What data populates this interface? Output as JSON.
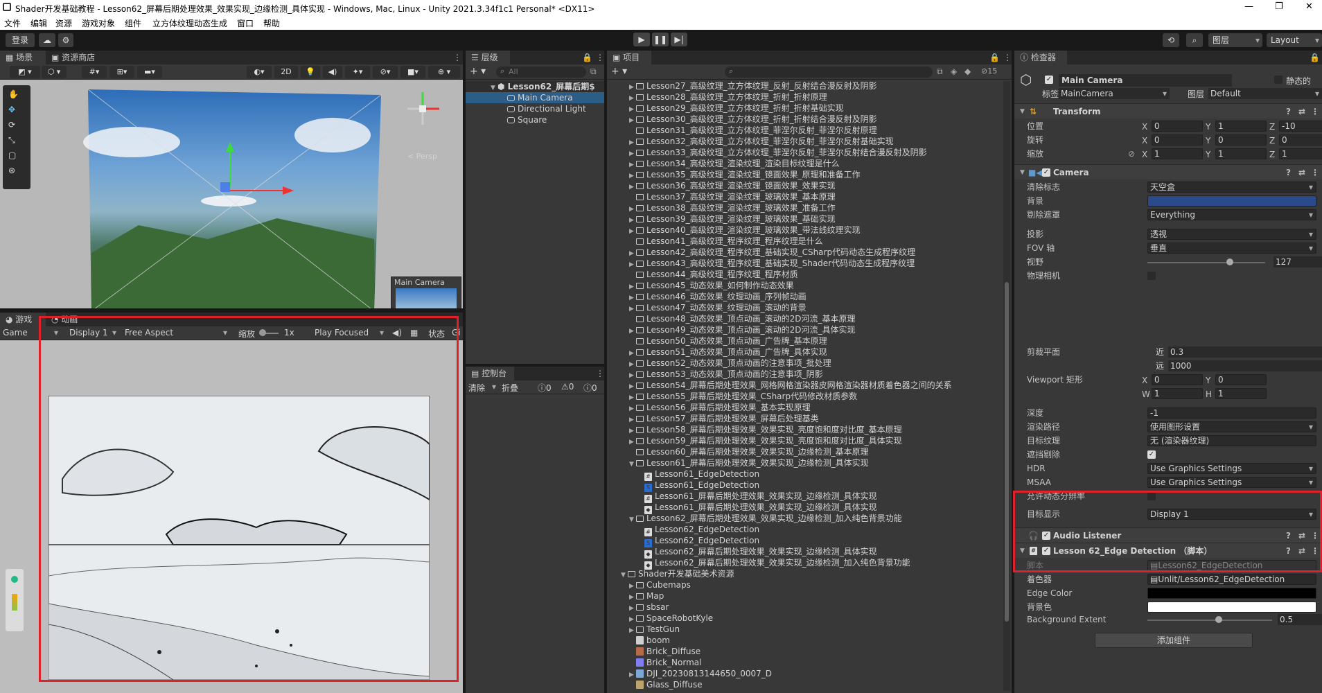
{
  "window": {
    "title": "Shader开发基础教程 - Lesson62_屏幕后期处理效果_效果实现_边缘检测_具体实现 - Windows, Mac, Linux - Unity 2021.3.34f1c1 Personal* <DX11>"
  },
  "menu": [
    "文件",
    "编辑",
    "资源",
    "游戏对象",
    "组件",
    "立方体纹理动态生成",
    "窗口",
    "帮助"
  ],
  "toolbar": {
    "login": "登录",
    "layers": "图层",
    "layout": "Layout"
  },
  "scene": {
    "tab": "场景",
    "store_tab": "资源商店",
    "mode_2d": "2D",
    "persp": "< Persp",
    "cam_preview": "Main Camera"
  },
  "game": {
    "tab": "游戏",
    "anim_tab": "动画",
    "view": "Game",
    "display": "Display 1",
    "aspect": "Free Aspect",
    "scale_label": "缩放",
    "scale_value": "1x",
    "play_mode": "Play Focused",
    "stats": "状态",
    "gizmos": "Gi"
  },
  "hierarchy": {
    "tab": "层级",
    "search": "All",
    "scene": "Lesson62_屏幕后期$",
    "items": [
      "Main Camera",
      "Directional Light",
      "Square"
    ]
  },
  "console": {
    "tab": "控制台",
    "clear": "清除",
    "collapse": "折叠",
    "errors": "0",
    "warnings": "0",
    "logs": "0"
  },
  "project": {
    "tab": "项目",
    "count": "15",
    "rows": [
      {
        "d": 1,
        "f": 1,
        "o": 0,
        "t": "Lesson27_高级纹理_立方体纹理_反射_反射结合漫反射及阴影"
      },
      {
        "d": 1,
        "f": 1,
        "o": 0,
        "t": "Lesson28_高级纹理_立方体纹理_折射_折射原理"
      },
      {
        "d": 1,
        "f": 1,
        "o": 0,
        "t": "Lesson29_高级纹理_立方体纹理_折射_折射基础实现"
      },
      {
        "d": 1,
        "f": 1,
        "o": 0,
        "t": "Lesson30_高级纹理_立方体纹理_折射_折射结合漫反射及阴影"
      },
      {
        "d": 1,
        "f": 0,
        "o": 0,
        "t": "Lesson31_高级纹理_立方体纹理_菲涅尔反射_菲涅尔反射原理"
      },
      {
        "d": 1,
        "f": 1,
        "o": 0,
        "t": "Lesson32_高级纹理_立方体纹理_菲涅尔反射_菲涅尔反射基础实现"
      },
      {
        "d": 1,
        "f": 1,
        "o": 0,
        "t": "Lesson33_高级纹理_立方体纹理_菲涅尔反射_菲涅尔反射结合漫反射及阴影"
      },
      {
        "d": 1,
        "f": 1,
        "o": 0,
        "t": "Lesson34_高级纹理_渲染纹理_渲染目标纹理是什么"
      },
      {
        "d": 1,
        "f": 1,
        "o": 0,
        "t": "Lesson35_高级纹理_渲染纹理_镜面效果_原理和准备工作"
      },
      {
        "d": 1,
        "f": 1,
        "o": 0,
        "t": "Lesson36_高级纹理_渲染纹理_镜面效果_效果实现"
      },
      {
        "d": 1,
        "f": 0,
        "o": 0,
        "t": "Lesson37_高级纹理_渲染纹理_玻璃效果_基本原理"
      },
      {
        "d": 1,
        "f": 1,
        "o": 0,
        "t": "Lesson38_高级纹理_渲染纹理_玻璃效果_准备工作"
      },
      {
        "d": 1,
        "f": 1,
        "o": 0,
        "t": "Lesson39_高级纹理_渲染纹理_玻璃效果_基础实现"
      },
      {
        "d": 1,
        "f": 1,
        "o": 0,
        "t": "Lesson40_高级纹理_渲染纹理_玻璃效果_带法线纹理实现"
      },
      {
        "d": 1,
        "f": 0,
        "o": 0,
        "t": "Lesson41_高级纹理_程序纹理_程序纹理是什么"
      },
      {
        "d": 1,
        "f": 1,
        "o": 0,
        "t": "Lesson42_高级纹理_程序纹理_基础实现_CSharp代码动态生成程序纹理"
      },
      {
        "d": 1,
        "f": 1,
        "o": 0,
        "t": "Lesson43_高级纹理_程序纹理_基础实现_Shader代码动态生成程序纹理"
      },
      {
        "d": 1,
        "f": 0,
        "o": 0,
        "t": "Lesson44_高级纹理_程序纹理_程序材质"
      },
      {
        "d": 1,
        "f": 1,
        "o": 0,
        "t": "Lesson45_动态效果_如何制作动态效果"
      },
      {
        "d": 1,
        "f": 1,
        "o": 0,
        "t": "Lesson46_动态效果_纹理动画_序列帧动画"
      },
      {
        "d": 1,
        "f": 1,
        "o": 0,
        "t": "Lesson47_动态效果_纹理动画_滚动的背景"
      },
      {
        "d": 1,
        "f": 0,
        "o": 0,
        "t": "Lesson48_动态效果_顶点动画_滚动的2D河流_基本原理"
      },
      {
        "d": 1,
        "f": 1,
        "o": 0,
        "t": "Lesson49_动态效果_顶点动画_滚动的2D河流_具体实现"
      },
      {
        "d": 1,
        "f": 0,
        "o": 0,
        "t": "Lesson50_动态效果_顶点动画_广告牌_基本原理"
      },
      {
        "d": 1,
        "f": 1,
        "o": 0,
        "t": "Lesson51_动态效果_顶点动画_广告牌_具体实现"
      },
      {
        "d": 1,
        "f": 1,
        "o": 0,
        "t": "Lesson52_动态效果_顶点动画的注意事项_批处理"
      },
      {
        "d": 1,
        "f": 1,
        "o": 0,
        "t": "Lesson53_动态效果_顶点动画的注意事项_阴影"
      },
      {
        "d": 1,
        "f": 1,
        "o": 0,
        "t": "Lesson54_屏幕后期处理效果_网格网格渲染器皮网格渲染器材质着色器之间的关系"
      },
      {
        "d": 1,
        "f": 1,
        "o": 0,
        "t": "Lesson55_屏幕后期处理效果_CSharp代码修改材质参数"
      },
      {
        "d": 1,
        "f": 1,
        "o": 0,
        "t": "Lesson56_屏幕后期处理效果_基本实现原理"
      },
      {
        "d": 1,
        "f": 1,
        "o": 0,
        "t": "Lesson57_屏幕后期处理效果_屏幕后处理基类"
      },
      {
        "d": 1,
        "f": 1,
        "o": 0,
        "t": "Lesson58_屏幕后期处理效果_效果实现_亮度饱和度对比度_基本原理"
      },
      {
        "d": 1,
        "f": 1,
        "o": 0,
        "t": "Lesson59_屏幕后期处理效果_效果实现_亮度饱和度对比度_具体实现"
      },
      {
        "d": 1,
        "f": 0,
        "o": 0,
        "t": "Lesson60_屏幕后期处理效果_效果实现_边缘检测_基本原理"
      },
      {
        "d": 1,
        "f": 1,
        "o": 1,
        "t": "Lesson61_屏幕后期处理效果_效果实现_边缘检测_具体实现"
      },
      {
        "d": 2,
        "f": 0,
        "o": 0,
        "i": "c",
        "t": "Lesson61_EdgeDetection"
      },
      {
        "d": 2,
        "f": 0,
        "o": 0,
        "i": "s",
        "t": "Lesson61_EdgeDetection"
      },
      {
        "d": 2,
        "f": 0,
        "o": 0,
        "i": "c",
        "t": "Lesson61_屏幕后期处理效果_效果实现_边缘检测_具体实现"
      },
      {
        "d": 2,
        "f": 0,
        "o": 0,
        "i": "u",
        "t": "Lesson61_屏幕后期处理效果_效果实现_边缘检测_具体实现"
      },
      {
        "d": 1,
        "f": 1,
        "o": 1,
        "t": "Lesson62_屏幕后期处理效果_效果实现_边缘检测_加入纯色背景功能"
      },
      {
        "d": 2,
        "f": 0,
        "o": 0,
        "i": "c",
        "t": "Lesson62_EdgeDetection"
      },
      {
        "d": 2,
        "f": 0,
        "o": 0,
        "i": "s",
        "t": "Lesson62_EdgeDetection"
      },
      {
        "d": 2,
        "f": 0,
        "o": 0,
        "i": "u",
        "t": "Lesson62_屏幕后期处理效果_效果实现_边缘检测_具体实现"
      },
      {
        "d": 2,
        "f": 0,
        "o": 0,
        "i": "u",
        "t": "Lesson62_屏幕后期处理效果_效果实现_边缘检测_加入纯色背景功能"
      },
      {
        "d": 0,
        "f": 1,
        "o": 1,
        "t": "Shader开发基础美术资源"
      },
      {
        "d": 1,
        "f": 1,
        "o": 0,
        "t": "Cubemaps"
      },
      {
        "d": 1,
        "f": 1,
        "o": 0,
        "t": "Map"
      },
      {
        "d": 1,
        "f": 1,
        "o": 0,
        "t": "sbsar"
      },
      {
        "d": 1,
        "f": 1,
        "o": 0,
        "t": "SpaceRobotKyle"
      },
      {
        "d": 1,
        "f": 1,
        "o": 0,
        "t": "TestGun"
      },
      {
        "d": 1,
        "f": 0,
        "o": 0,
        "i": "m",
        "t": "boom"
      },
      {
        "d": 1,
        "f": 0,
        "o": 0,
        "i": "b",
        "t": "Brick_Diffuse"
      },
      {
        "d": 1,
        "f": 0,
        "o": 0,
        "i": "n",
        "t": "Brick_Normal"
      },
      {
        "d": 1,
        "f": 1,
        "o": 0,
        "i": "p",
        "t": "DJI_20230813144650_0007_D"
      },
      {
        "d": 1,
        "f": 0,
        "o": 0,
        "i": "g",
        "t": "Glass_Diffuse"
      }
    ]
  },
  "inspector": {
    "tab": "检查器",
    "object_name": "Main Camera",
    "static": "静态的",
    "tag_label": "标签",
    "tag": "MainCamera",
    "layer_label": "图层",
    "layer": "Default",
    "transform": {
      "title": "Transform",
      "pos": "位置",
      "rot": "旋转",
      "scale": "缩放",
      "p": [
        "0",
        "1",
        "-10"
      ],
      "r": [
        "0",
        "0",
        "0"
      ],
      "s": [
        "1",
        "1",
        "1"
      ]
    },
    "camera": {
      "title": "Camera",
      "rows": [
        {
          "l": "清除标志",
          "v": "天空盒",
          "k": "dd"
        },
        {
          "l": "背景",
          "v": "",
          "k": "color",
          "c": "#2a4a8c"
        },
        {
          "l": "剔除遮罩",
          "v": "Everything",
          "k": "dd"
        },
        {
          "l": "投影",
          "v": "透视",
          "k": "dd"
        },
        {
          "l": "FOV 轴",
          "v": "垂直",
          "k": "dd"
        },
        {
          "l": "视野",
          "v": "127",
          "k": "slider"
        },
        {
          "l": "物理相机",
          "v": "",
          "k": "check0"
        }
      ],
      "clip_label": "剪裁平面",
      "near_label": "近",
      "near": "0.3",
      "far_label": "远",
      "far": "1000",
      "viewport_label": "Viewport 矩形",
      "vx": "0",
      "vy": "0",
      "vw": "1",
      "vh": "1",
      "rows2": [
        {
          "l": "深度",
          "v": "-1",
          "k": "text"
        },
        {
          "l": "渲染路径",
          "v": "使用图形设置",
          "k": "dd"
        },
        {
          "l": "目标纹理",
          "v": "无 (渲染器纹理)",
          "k": "obj"
        },
        {
          "l": "遮挡剔除",
          "v": "",
          "k": "check1"
        },
        {
          "l": "HDR",
          "v": "Use Graphics Settings",
          "k": "dd"
        },
        {
          "l": "MSAA",
          "v": "Use Graphics Settings",
          "k": "dd"
        },
        {
          "l": "允许动态分辨率",
          "v": "",
          "k": "check0"
        },
        {
          "l": "目标显示",
          "v": "Display 1",
          "k": "dd"
        }
      ]
    },
    "audio": {
      "title": "Audio Listener"
    },
    "edge": {
      "title": "Lesson 62_Edge Detection （脚本）",
      "script_label": "脚本",
      "script": "Lesson62_EdgeDetection",
      "shader_label": "着色器",
      "shader": "Unlit/Lesson62_EdgeDetection",
      "edge_color_label": "Edge Color",
      "bg_label": "背景色",
      "bg_extent_label": "Background Extent",
      "bg_extent": "0.5"
    },
    "add_component": "添加组件"
  },
  "colors": {
    "highlight": "#e0202a",
    "bg": "#383838",
    "dark": "#282828"
  }
}
